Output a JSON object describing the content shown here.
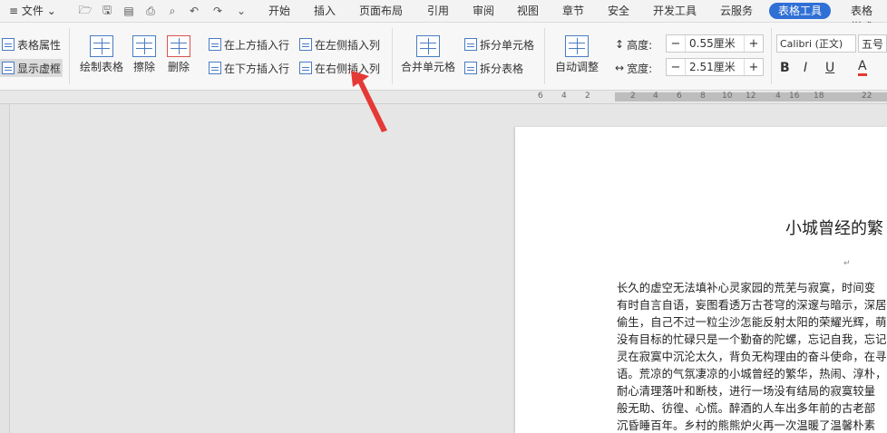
{
  "menu": {
    "file_label": "文件"
  },
  "tabs": [
    "开始",
    "插入",
    "页面布局",
    "引用",
    "审阅",
    "视图",
    "章节",
    "安全",
    "开发工具",
    "云服务",
    "表格工具",
    "表格样式"
  ],
  "active_tab": "表格工具",
  "ribbon": {
    "table_properties": "表格属性",
    "show_gridlines": "显示虚框",
    "draw_table": "绘制表格",
    "erase": "擦除",
    "delete": "删除",
    "insert_above": "在上方插入行",
    "insert_below": "在下方插入行",
    "insert_left": "在左侧插入列",
    "insert_right": "在右侧插入列",
    "merge_cells": "合并单元格",
    "split_cells": "拆分单元格",
    "split_table": "拆分表格",
    "auto_fit": "自动调整",
    "height_label": "高度:",
    "height_value": "0.55厘米",
    "width_label": "宽度:",
    "width_value": "2.51厘米",
    "font_name": "Calibri (正文)",
    "font_size": "五号",
    "bold": "B",
    "italic": "I",
    "underline": "U",
    "font_color": "A"
  },
  "ruler": {
    "marks": [
      "6",
      "4",
      "2",
      "2",
      "4",
      "6",
      "8",
      "10",
      "12",
      "4",
      "16",
      "18",
      "22"
    ]
  },
  "document": {
    "title": "小城曾经的繁",
    "lines": [
      "长久的虚空无法填补心灵家园的荒芜与寂寞，时间变",
      "有时自言自语，妄图看透万古苍穹的深邃与暗示，深居",
      "偷生，自己不过一粒尘沙怎能反射太阳的荣耀光辉，萌",
      "没有目标的忙碌只是一个勤奋的陀螺，忘记自我，忘记",
      "灵在寂寞中沉沦太久，背负无构理由的奋斗使命，在寻",
      "语。荒凉的气氛凄凉的小城曾经的繁华，热闹、淳朴，北",
      "耐心清理落叶和断枝，进行一场没有结局的寂寞较量",
      "般无助、彷徨、心慌。醉酒的人车出多年前的古老部",
      "沉昏睡百年。乡村的熊熊炉火再一次温暖了温馨朴素"
    ]
  },
  "colors": {
    "accent": "#2f6fd6",
    "arrow": "#e53935"
  }
}
